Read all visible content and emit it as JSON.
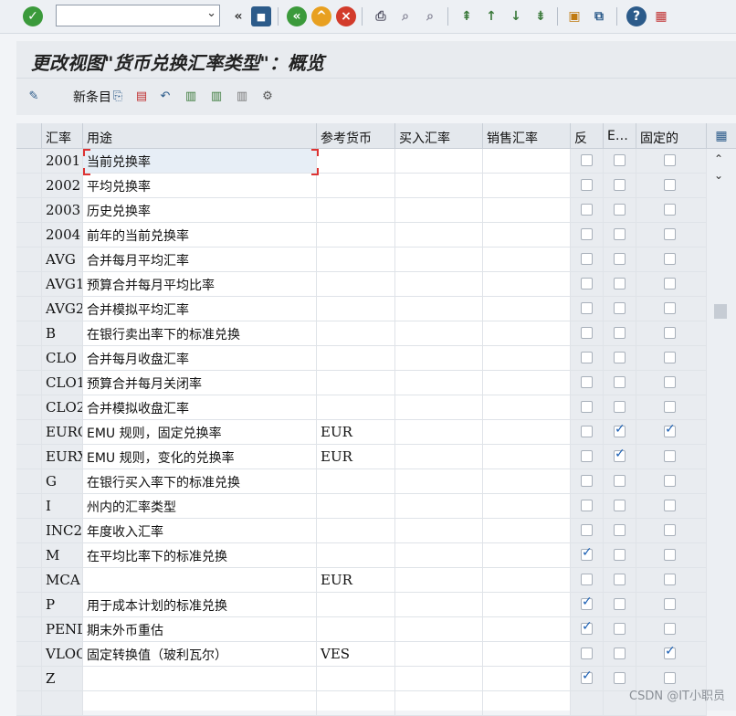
{
  "toolbar": {
    "command_value": "",
    "icons": [
      "enter-icon",
      "back-icon",
      "save-icon",
      "nav-back-icon",
      "exit-icon",
      "cancel-icon",
      "print-icon",
      "find-icon",
      "find-next-icon",
      "first-page-icon",
      "prev-page-icon",
      "next-page-icon",
      "last-page-icon",
      "new-session-icon",
      "shortcut-icon",
      "help-icon",
      "layout-icon"
    ]
  },
  "title": "更改视图\"货币兑换汇率类型\"：概览",
  "app_toolbar": {
    "new_entries_label": "新条目"
  },
  "table": {
    "headers": {
      "rate": "汇率",
      "usage": "用途",
      "ref_currency": "参考货币",
      "buy_rate": "买入汇率",
      "sell_rate": "销售汇率",
      "inverse": "反",
      "emu": "E…",
      "fixed": "固定的"
    },
    "rows": [
      {
        "rate": "2001",
        "usage": "当前兑换率",
        "ref": "",
        "inv": false,
        "emu": false,
        "fix": false
      },
      {
        "rate": "2002",
        "usage": "平均兑换率",
        "ref": "",
        "inv": false,
        "emu": false,
        "fix": false
      },
      {
        "rate": "2003",
        "usage": "历史兑换率",
        "ref": "",
        "inv": false,
        "emu": false,
        "fix": false
      },
      {
        "rate": "2004",
        "usage": "前年的当前兑换率",
        "ref": "",
        "inv": false,
        "emu": false,
        "fix": false
      },
      {
        "rate": "AVG",
        "usage": "合并每月平均汇率",
        "ref": "",
        "inv": false,
        "emu": false,
        "fix": false
      },
      {
        "rate": "AVG1",
        "usage": "预算合并每月平均比率",
        "ref": "",
        "inv": false,
        "emu": false,
        "fix": false
      },
      {
        "rate": "AVG2",
        "usage": "合并模拟平均汇率",
        "ref": "",
        "inv": false,
        "emu": false,
        "fix": false
      },
      {
        "rate": "B",
        "usage": "在银行卖出率下的标准兑换",
        "ref": "",
        "inv": false,
        "emu": false,
        "fix": false
      },
      {
        "rate": "CLO",
        "usage": "合并每月收盘汇率",
        "ref": "",
        "inv": false,
        "emu": false,
        "fix": false
      },
      {
        "rate": "CLO1",
        "usage": "预算合并每月关闭率",
        "ref": "",
        "inv": false,
        "emu": false,
        "fix": false
      },
      {
        "rate": "CLO2",
        "usage": "合并模拟收盘汇率",
        "ref": "",
        "inv": false,
        "emu": false,
        "fix": false
      },
      {
        "rate": "EURO",
        "usage": "EMU 规则，固定兑换率",
        "ref": "EUR",
        "inv": false,
        "emu": true,
        "fix": true
      },
      {
        "rate": "EURX",
        "usage": "EMU 规则，变化的兑换率",
        "ref": "EUR",
        "inv": false,
        "emu": true,
        "fix": false
      },
      {
        "rate": "G",
        "usage": "在银行买入率下的标准兑换",
        "ref": "",
        "inv": false,
        "emu": false,
        "fix": false
      },
      {
        "rate": "I",
        "usage": "州内的汇率类型",
        "ref": "",
        "inv": false,
        "emu": false,
        "fix": false
      },
      {
        "rate": "INC2",
        "usage": "年度收入汇率",
        "ref": "",
        "inv": false,
        "emu": false,
        "fix": false
      },
      {
        "rate": "M",
        "usage": "在平均比率下的标准兑换",
        "ref": "",
        "inv": true,
        "emu": false,
        "fix": false
      },
      {
        "rate": "MCA",
        "usage": "",
        "ref": "EUR",
        "inv": false,
        "emu": false,
        "fix": false
      },
      {
        "rate": "P",
        "usage": "用于成本计划的标准兑换",
        "ref": "",
        "inv": true,
        "emu": false,
        "fix": false
      },
      {
        "rate": "PEND",
        "usage": "期末外币重估",
        "ref": "",
        "inv": true,
        "emu": false,
        "fix": false
      },
      {
        "rate": "VLOC",
        "usage": "固定转换值（玻利瓦尔）",
        "ref": "VES",
        "inv": false,
        "emu": false,
        "fix": true
      },
      {
        "rate": "Z",
        "usage": "",
        "ref": "",
        "inv": true,
        "emu": false,
        "fix": false
      }
    ]
  },
  "watermark": "CSDN @IT小职员"
}
